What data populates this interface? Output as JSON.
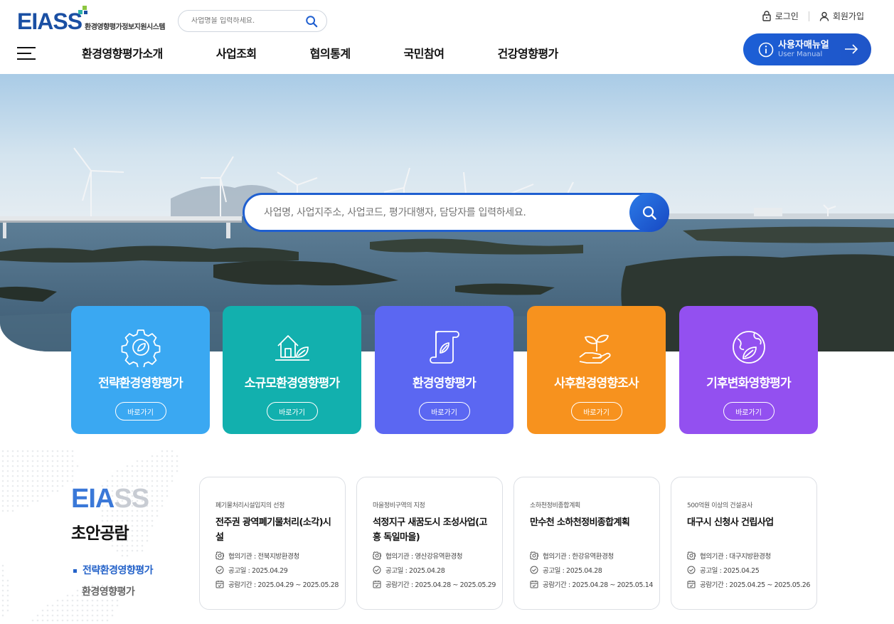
{
  "header": {
    "logo_text": "EIASS",
    "logo_sub": "환경영향평가정보지원시스템",
    "search_placeholder": "사업명을 입력하세요.",
    "nav": [
      "환경영향평가소개",
      "사업조회",
      "협의통계",
      "국민참여",
      "건강영향평가"
    ],
    "login": "로그인",
    "signup": "회원가입",
    "manual_title": "사용자매뉴얼",
    "manual_sub": "User Manual"
  },
  "hero": {
    "search_placeholder": "사업명, 사업지주소, 사업코드, 평가대행자, 담당자를 입력하세요."
  },
  "categories": [
    {
      "title": "전략환경영향평가",
      "button": "바로가기",
      "color": "#3aa8f2",
      "icon": "gear-leaf-icon"
    },
    {
      "title": "소규모환경영향평가",
      "button": "바로가기",
      "color": "#12b0ae",
      "icon": "house-leaf-icon"
    },
    {
      "title": "환경영향평가",
      "button": "바로가기",
      "color": "#5b67f2",
      "icon": "scroll-leaf-icon"
    },
    {
      "title": "사후환경영향조사",
      "button": "바로가기",
      "color": "#f7921e",
      "icon": "hand-sprout-icon"
    },
    {
      "title": "기후변화영향평가",
      "button": "바로가기",
      "color": "#9350f0",
      "icon": "globe-leaf-icon"
    }
  ],
  "notice": {
    "brand_a": "EIA",
    "brand_b": "SS",
    "title": "초안공람",
    "tabs": [
      "전략환경영향평가",
      "환경영향평가"
    ],
    "items": [
      {
        "category": "폐기물처리시설입지의 선정",
        "title": "전주권 광역폐기물처리(소각)시설",
        "agency": "협의기관 : 전북지방환경청",
        "notice_date": "공고일 : 2025.04.29",
        "period": "공람기간 : 2025.04.29 ~ 2025.05.28"
      },
      {
        "category": "마을정비구역의 지정",
        "title": "석정지구 새꿈도시 조성사업(고흥 독일마을)",
        "agency": "협의기관 : 영산강유역환경청",
        "notice_date": "공고일 : 2025.04.28",
        "period": "공람기간 : 2025.04.28 ~ 2025.05.29"
      },
      {
        "category": "소하천정비종합계획",
        "title": "만수천 소하천정비종합계획",
        "agency": "협의기관 : 한강유역환경청",
        "notice_date": "공고일 : 2025.04.28",
        "period": "공람기간 : 2025.04.28 ~ 2025.05.14"
      },
      {
        "category": "500억원 이상의 건설공사",
        "title": "대구시 신청사 건립사업",
        "agency": "협의기관 : 대구지방환경청",
        "notice_date": "공고일 : 2025.04.25",
        "period": "공람기간 : 2025.04.25 ~ 2025.05.26"
      }
    ]
  }
}
